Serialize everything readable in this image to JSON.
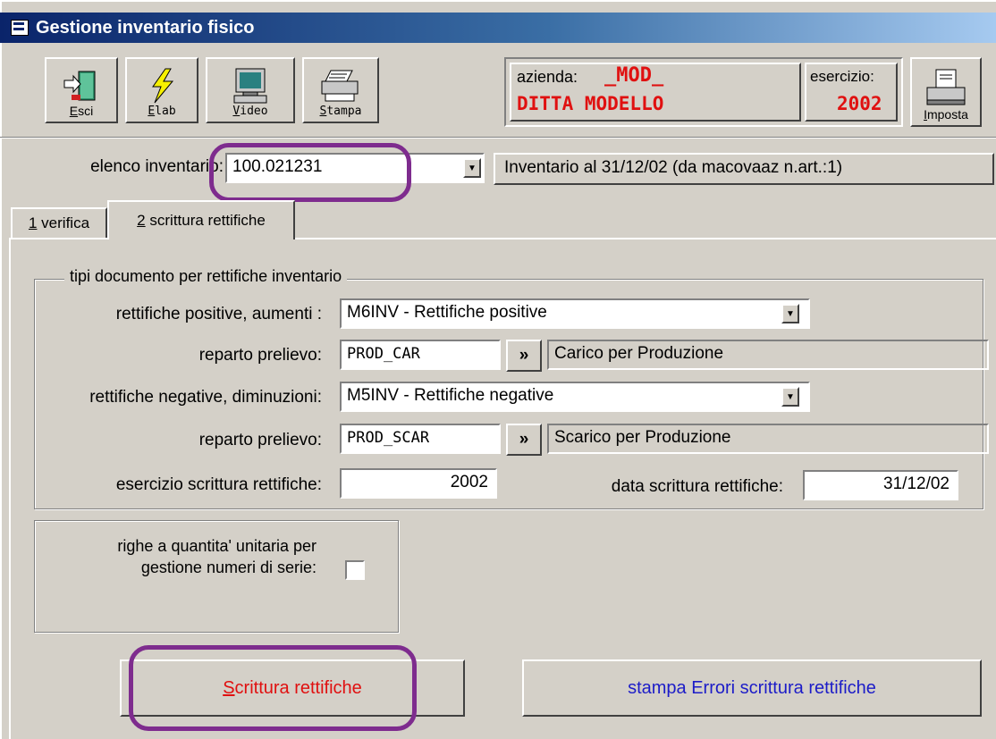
{
  "window": {
    "title": "Gestione inventario fisico"
  },
  "toolbar": {
    "esci": "Esci",
    "elab": "Elab",
    "video": "Video",
    "stampa": "Stampa",
    "imposta": "Imposta"
  },
  "company": {
    "azienda_label": "azienda:",
    "azienda_code": "_MOD_",
    "azienda_name": "DITTA MODELLO",
    "esercizio_label": "esercizio:",
    "esercizio_value": "2002"
  },
  "inventory": {
    "label": "elenco inventario:",
    "value": "100.021231",
    "description": "Inventario al 31/12/02 (da macovaaz n.art.:1)"
  },
  "tabs": [
    {
      "num": "1",
      "label": "verifica"
    },
    {
      "num": "2",
      "label": "scrittura rettifiche"
    }
  ],
  "group": {
    "title": "tipi documento per rettifiche inventario",
    "pos_label": "rettifiche positive, aumenti :",
    "pos_value": "M6INV - Rettifiche positive",
    "rep1_label": "reparto prelievo:",
    "rep1_code": "PROD_CAR",
    "rep1_desc": "Carico per Produzione",
    "neg_label": "rettifiche negative, diminuzioni:",
    "neg_value": "M5INV - Rettifiche negative",
    "rep2_label": "reparto prelievo:",
    "rep2_code": "PROD_SCAR",
    "rep2_desc": "Scarico per Produzione",
    "lookup_glyph": "»",
    "eserc_label": "esercizio scrittura rettifiche:",
    "eserc_value": "2002",
    "data_label": "data scrittura rettifiche:",
    "data_value": "31/12/02"
  },
  "serial": {
    "label_line1": "righe a quantita' unitaria per",
    "label_line2": "gestione numeri di serie:",
    "checked": false
  },
  "actions": {
    "scrittura": "Scrittura rettifiche",
    "stampa_errori": "stampa Errori scrittura rettifiche"
  },
  "colors": {
    "highlight_circle": "#7e2c8e",
    "scrittura_text": "#e01010",
    "stampa_text": "#1c1cc8"
  }
}
